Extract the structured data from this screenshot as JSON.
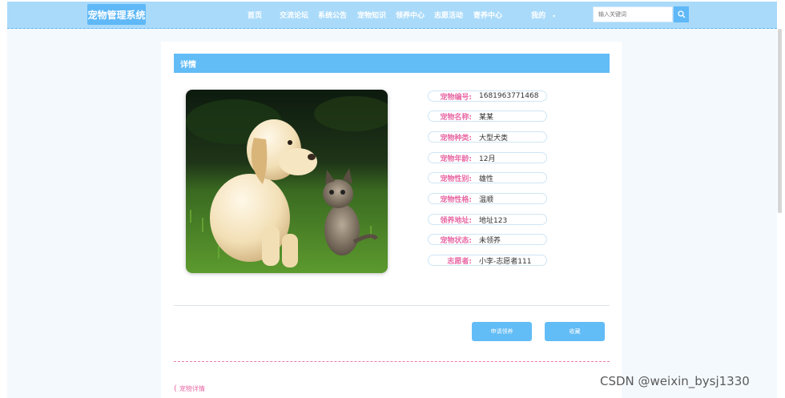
{
  "header": {
    "brand": "宠物管理系统",
    "nav": [
      {
        "label": "首页"
      },
      {
        "label": "交流论坛"
      },
      {
        "label": "系统公告"
      },
      {
        "label": "宠物知识"
      },
      {
        "label": "领养中心"
      },
      {
        "label": "志愿活动"
      },
      {
        "label": "寄养中心"
      },
      {
        "label": "我的"
      }
    ],
    "search": {
      "placeholder": "输入关键词"
    }
  },
  "section": {
    "title": "详情"
  },
  "pet": {
    "fields": [
      {
        "label": "宠物编号:",
        "value": "1681963771468"
      },
      {
        "label": "宠物名称:",
        "value": "某某"
      },
      {
        "label": "宠物种类:",
        "value": "大型犬类"
      },
      {
        "label": "宠物年龄:",
        "value": "12月"
      },
      {
        "label": "宠物性别:",
        "value": "雄性"
      },
      {
        "label": "宠物性格:",
        "value": "温顺"
      },
      {
        "label": "领养地址:",
        "value": "地址123"
      },
      {
        "label": "宠物状态:",
        "value": "未领养"
      },
      {
        "label": "志愿者:",
        "value": "小李-志愿者111"
      }
    ]
  },
  "actions": {
    "apply": "申请领养",
    "favorite": "收藏"
  },
  "tabs": {
    "detail": "宠物详情"
  },
  "watermark": "CSDN @weixin_bysj1330",
  "colors": {
    "accent": "#62bcf6",
    "label": "#e86aa5",
    "header_bg": "#a9dafa"
  }
}
